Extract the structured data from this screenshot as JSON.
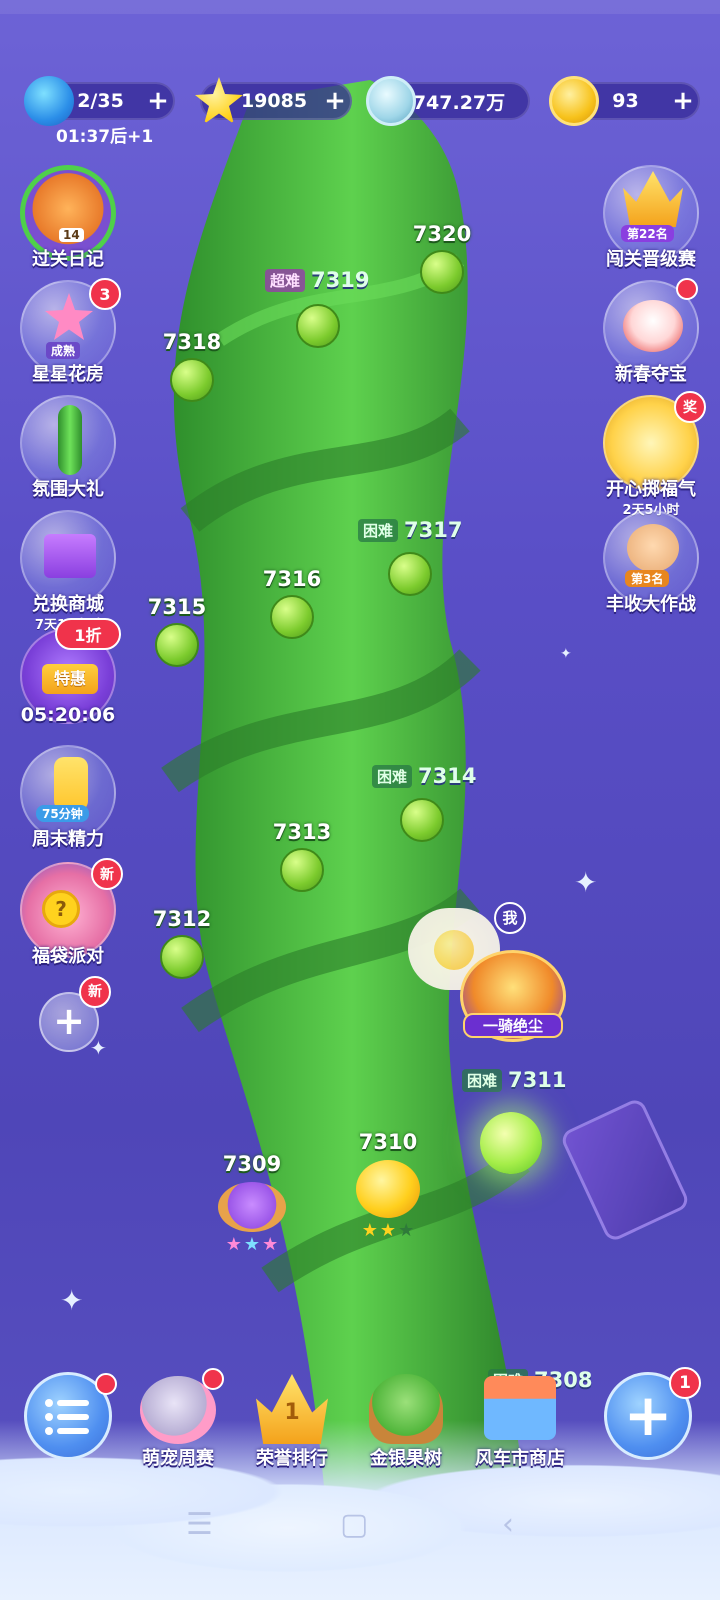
{
  "resources": {
    "energy": {
      "value": "2/35",
      "timer": "01:37后+1",
      "icon": "lightning-icon"
    },
    "stars": {
      "value": "19085",
      "icon": "star-icon"
    },
    "coins": {
      "value": "747.27万",
      "icon": "silver-coin-icon"
    },
    "gold": {
      "value": "93",
      "icon": "gold-coin-icon"
    },
    "plus": "+"
  },
  "left_menu": [
    {
      "label": "过关日记",
      "inner": "14"
    },
    {
      "label": "星星花房",
      "inner": "成熟",
      "badge": "3"
    },
    {
      "label": "氛围大礼"
    },
    {
      "label": "兑换商城",
      "sub": "7天15小时"
    },
    {
      "label": "05:20:06",
      "inner": "特惠",
      "badge": "1折"
    },
    {
      "label": "周末精力",
      "inner": "75分钟"
    },
    {
      "label": "福袋派对",
      "badge": "新"
    },
    {
      "badge": "新",
      "inner": "+"
    }
  ],
  "right_menu": [
    {
      "label": "闯关晋级赛",
      "inner": "第22名"
    },
    {
      "label": "新春夺宝"
    },
    {
      "label": "开心掷福气",
      "sub": "2天5小时",
      "badge": "奖"
    },
    {
      "label": "丰收大作战",
      "inner": "第3名"
    }
  ],
  "levels": [
    {
      "num": "7320"
    },
    {
      "num": "7319",
      "tag": "超难"
    },
    {
      "num": "7318"
    },
    {
      "num": "7317",
      "tag": "困难"
    },
    {
      "num": "7316"
    },
    {
      "num": "7315"
    },
    {
      "num": "7314",
      "tag": "困难"
    },
    {
      "num": "7313"
    },
    {
      "num": "7312"
    },
    {
      "num": "7311",
      "tag": "困难"
    },
    {
      "num": "7310",
      "stars": 2
    },
    {
      "num": "7309",
      "stars": 3
    },
    {
      "num": "7308",
      "tag": "困难"
    }
  ],
  "player": {
    "me_label": "我",
    "title": "一骑绝尘"
  },
  "bottom_nav": [
    {
      "label": "萌宠周赛"
    },
    {
      "label": "荣誉排行",
      "inner": "1"
    },
    {
      "label": "金银果树"
    },
    {
      "label": "风车市商店"
    }
  ],
  "plus_button_badge": "1",
  "colors": {
    "bg": "#5a4fc7",
    "badge": "#f0334b",
    "stalk": "#3fae3a"
  }
}
